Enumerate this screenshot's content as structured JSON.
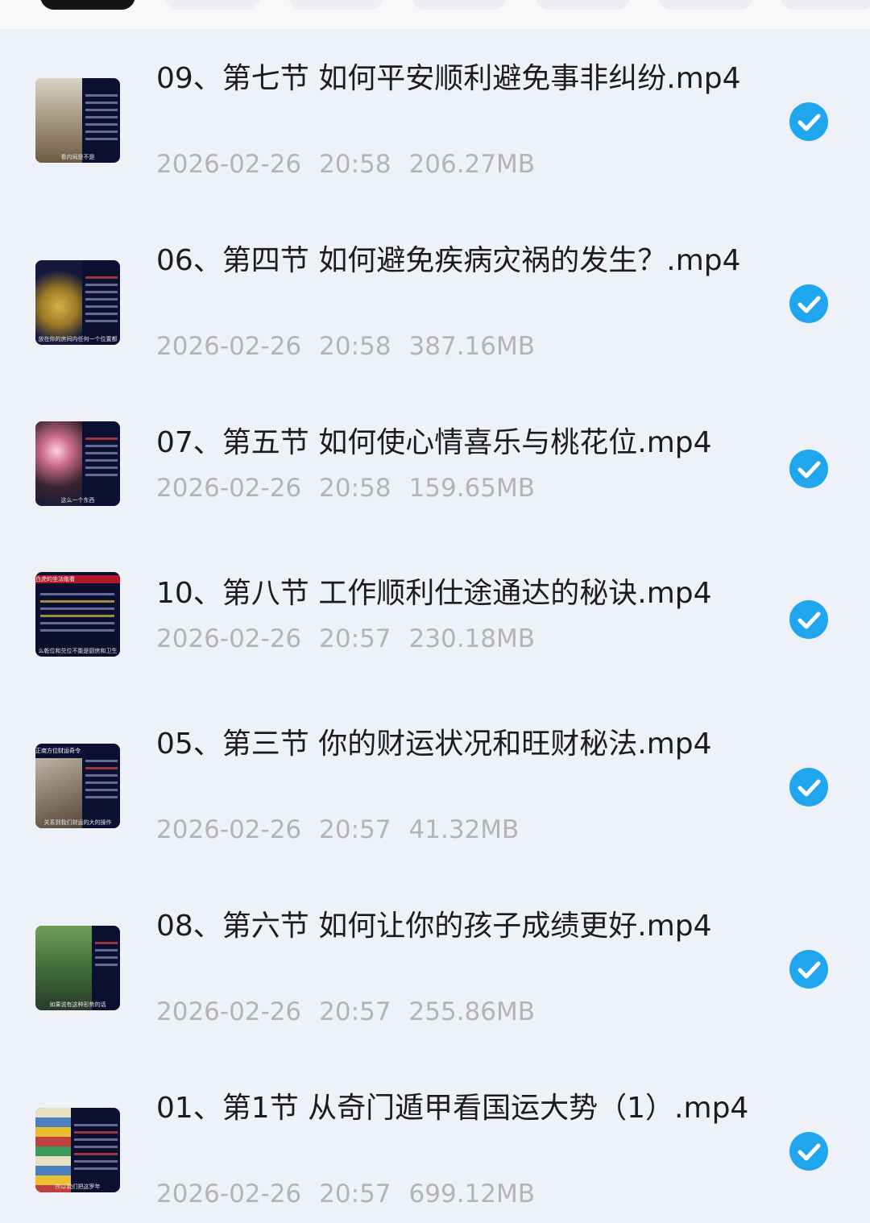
{
  "accent_color": "#1fa6ee",
  "files": [
    {
      "name": "09、第七节 如何平安顺利避免事非纠纷.mp4",
      "date": "2026-02-26",
      "time": "20:58",
      "size": "206.27MB",
      "thumb_caption": "看内局是不是",
      "thumb_top": "",
      "icon": "video-thumbnail",
      "checked": true
    },
    {
      "name": "06、第四节 如何避免疾病灾祸的发生？.mp4",
      "date": "2026-02-26",
      "time": "20:58",
      "size": "387.16MB",
      "thumb_caption": "放在你的房间内任何一个位置都",
      "thumb_top": "",
      "icon": "video-thumbnail",
      "checked": true
    },
    {
      "name": "07、第五节 如何使心情喜乐与桃花位.mp4",
      "date": "2026-02-26",
      "time": "20:58",
      "size": "159.65MB",
      "thumb_caption": "这么一个东西",
      "thumb_top": "",
      "icon": "video-thumbnail",
      "checked": true
    },
    {
      "name": "10、第八节 工作顺利仕途通达的秘诀.mp4",
      "date": "2026-02-26",
      "time": "20:57",
      "size": "230.18MB",
      "thumb_caption": "么乾位和兑位不能是厨房和卫生",
      "thumb_top": "白虎的坐法临看",
      "icon": "video-thumbnail",
      "checked": true
    },
    {
      "name": "05、第三节 你的财运状况和旺财秘法.mp4",
      "date": "2026-02-26",
      "time": "20:57",
      "size": "41.32MB",
      "thumb_caption": "关系到我们财运的大的操作",
      "thumb_top": "正南方位财运奇令",
      "icon": "video-thumbnail",
      "checked": true
    },
    {
      "name": "08、第六节 如何让你的孩子成绩更好.mp4",
      "date": "2026-02-26",
      "time": "20:57",
      "size": "255.86MB",
      "thumb_caption": "如果说有这种形势的话",
      "thumb_top": "",
      "icon": "video-thumbnail",
      "checked": true
    },
    {
      "name": "01、第1节 从奇门遁甲看国运大势（1）.mp4",
      "date": "2026-02-26",
      "time": "20:57",
      "size": "699.12MB",
      "thumb_caption": "所以我们把这罗年",
      "thumb_top": "",
      "icon": "video-thumbnail",
      "checked": true
    }
  ]
}
